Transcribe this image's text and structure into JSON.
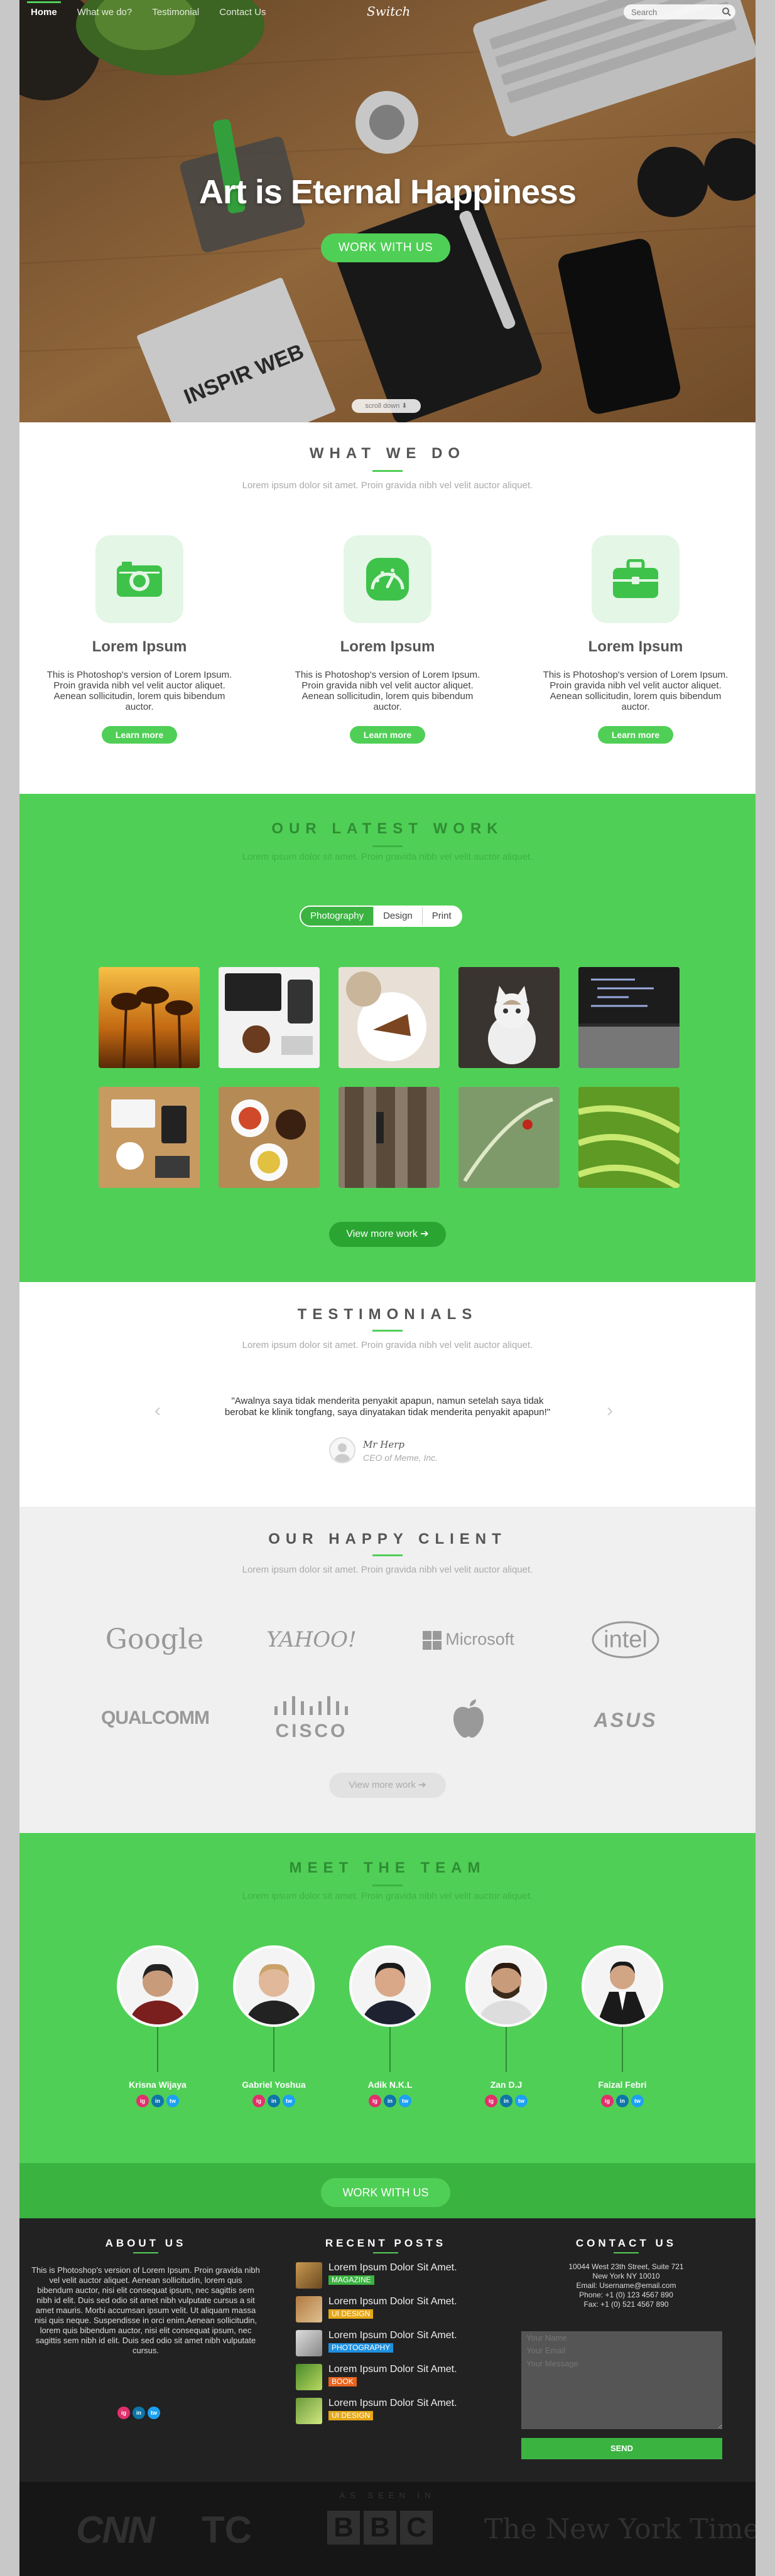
{
  "nav": {
    "items": [
      {
        "label": "Home",
        "active": true
      },
      {
        "label": "What we do?",
        "active": false
      },
      {
        "label": "Testimonial",
        "active": false
      },
      {
        "label": "Contact Us",
        "active": false
      }
    ],
    "brand": "Switch",
    "search_placeholder": "Search"
  },
  "hero": {
    "title": "Art is Eternal Happiness",
    "button": "WORK WITH US",
    "scroll_label": "scroll down ⬇",
    "magazine_text": "INSPIR WEB"
  },
  "what_we_do": {
    "title": "WHAT WE DO",
    "subtitle": "Lorem ipsum dolor sit amet. Proin gravida nibh vel velit auctor aliquet.",
    "services": [
      {
        "icon": "camera-icon",
        "title": "Lorem Ipsum",
        "text": "This is Photoshop's version of Lorem Ipsum. Proin gravida nibh vel velit auctor aliquet. Aenean sollicitudin, lorem quis bibendum auctor.",
        "button": "Learn more"
      },
      {
        "icon": "dashboard-icon",
        "title": "Lorem Ipsum",
        "text": "This is Photoshop's version of Lorem Ipsum. Proin gravida nibh vel velit auctor aliquet. Aenean sollicitudin, lorem quis bibendum auctor.",
        "button": "Learn more"
      },
      {
        "icon": "briefcase-icon",
        "title": "Lorem Ipsum",
        "text": "This is Photoshop's version of Lorem Ipsum. Proin gravida nibh vel velit auctor aliquet. Aenean sollicitudin, lorem quis bibendum auctor.",
        "button": "Learn more"
      }
    ]
  },
  "latest_work": {
    "title": "OUR LATEST WORK",
    "subtitle": "Lorem ipsum dolor sit amet. Proin gravida nibh vel velit auctor aliquet.",
    "filters": [
      "Photography",
      "Design",
      "Print"
    ],
    "active_filter": "Photography",
    "gallery": [
      "sunset-trees-photo",
      "desk-workspace-photo",
      "cake-coffee-photo",
      "kitten-photo",
      "laptop-code-photo",
      "flatlay-desk-photo",
      "food-table-photo",
      "wood-planks-photo",
      "ladybug-leaf-photo",
      "green-leaves-photo"
    ],
    "button": "View more work ➔"
  },
  "testimonials": {
    "title": "TESTIMONIALS",
    "subtitle": "Lorem ipsum dolor sit amet. Proin gravida nibh vel velit auctor aliquet.",
    "quote": "\"Awalnya saya tidak menderita penyakit apapun, namun setelah saya tidak berobat ke klinik tongfang, saya dinyatakan tidak menderita penyakit apapun!\"",
    "author": "Mr Herp",
    "role": "CEO of Meme, Inc.",
    "prev": "‹",
    "next": "›"
  },
  "clients": {
    "title": "OUR HAPPY CLIENT",
    "subtitle": "Lorem ipsum dolor sit amet. Proin gravida nibh vel velit auctor aliquet.",
    "logos": [
      "Google",
      "YAHOO!",
      "Microsoft",
      "intel",
      "QUALCOMM",
      "CISCO",
      "apple-logo",
      "ASUS"
    ],
    "button": "View more work ➔"
  },
  "team": {
    "title": "MEET THE TEAM",
    "subtitle": "Lorem ipsum dolor sit amet. Proin gravida nibh vel velit auctor aliquet.",
    "members": [
      "Krisna Wijaya",
      "Gabriel Yoshua",
      "Adik N.K.L",
      "Zan D.J",
      "Faizal Febri"
    ],
    "social": [
      "ig",
      "in",
      "tw"
    ],
    "button": "WORK WITH US"
  },
  "footer": {
    "about_title": "ABOUT US",
    "about_text": "This is Photoshop's version of Lorem Ipsum. Proin gravida nibh vel velit auctor aliquet. Aenean sollicitudin, lorem quis bibendum auctor, nisi elit consequat ipsum, nec sagittis sem nibh id elit. Duis sed odio sit amet nibh vulputate cursus a sit amet mauris. Morbi accumsan ipsum velit. Ut aliquam massa nisi quis neque. Suspendisse in orci enim.Aenean sollicitudin, lorem quis bibendum auctor, nisi elit consequat ipsum, nec sagittis sem nibh id elit. Duis sed odio sit amet nibh vulputate cursus.",
    "posts_title": "RECENT POSTS",
    "posts": [
      {
        "title": "Lorem Ipsum Dolor Sit Amet.",
        "tag": "MAGAZINE",
        "tag_color": "#3bb341"
      },
      {
        "title": "Lorem Ipsum Dolor Sit Amet.",
        "tag": "UI DESIGN",
        "tag_color": "#e6a817"
      },
      {
        "title": "Lorem Ipsum Dolor Sit Amet.",
        "tag": "PHOTOGRAPHY",
        "tag_color": "#1e90e0"
      },
      {
        "title": "Lorem Ipsum Dolor Sit Amet.",
        "tag": "BOOK",
        "tag_color": "#e8641e"
      },
      {
        "title": "Lorem Ipsum Dolor Sit Amet.",
        "tag": "UI DESIGN",
        "tag_color": "#e6a817"
      }
    ],
    "contact_title": "CONTACT US",
    "contact_lines": [
      "10044 West 23th Street, Suite 721",
      "New York NY 10010",
      "Email: Username@email.com",
      "Phone: +1 (0) 123 4567 890",
      "Fax: +1 (0) 521 4567 890"
    ],
    "name_placeholder": "Your Name",
    "email_placeholder": "Your Email",
    "message_placeholder": "Your Message",
    "send": "SEND"
  },
  "as_seen": {
    "title": "AS SEEN IN",
    "logos": [
      "CNN",
      "TC",
      "BBC",
      "The New York Times"
    ]
  },
  "colors": {
    "accent": "#50cf56",
    "accent_dark": "#3bb341",
    "footer": "#222222"
  }
}
